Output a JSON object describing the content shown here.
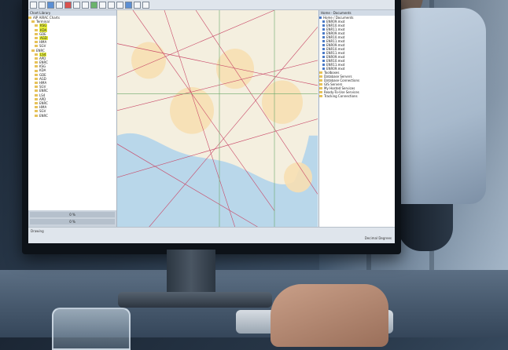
{
  "window": {
    "title": "",
    "left_panel_title": "Chart Library"
  },
  "left_tree": [
    "AIP AIRAC Charts",
    "Terminal",
    "KSG",
    "KDA",
    "GDE",
    "AGD",
    "HMA",
    "SGV",
    "ENRC",
    "LS4",
    "APD",
    "ENRC"
  ],
  "left_bottom": [
    "0 %",
    "0 %"
  ],
  "right_panel": {
    "title": "Home - Documents",
    "files": [
      "Home / Documents",
      "ENR09.mxd",
      "ENR10.mxd",
      "ENR11.mxd",
      "Toolboxes",
      "Database Servers",
      "Database Connections",
      "GIS Servers",
      "My Hosted Services",
      "Ready-To-Use Services",
      "Tracking Connections"
    ]
  },
  "status": {
    "left": "Drawing",
    "right": "Decimal Degrees"
  },
  "icons": [
    "folder-icon",
    "doc-icon"
  ],
  "colors": {
    "map_land": "#f4efdf",
    "map_water": "#b9d7ea",
    "route": "#c94b6a",
    "highlight": "#e7ef3a"
  }
}
